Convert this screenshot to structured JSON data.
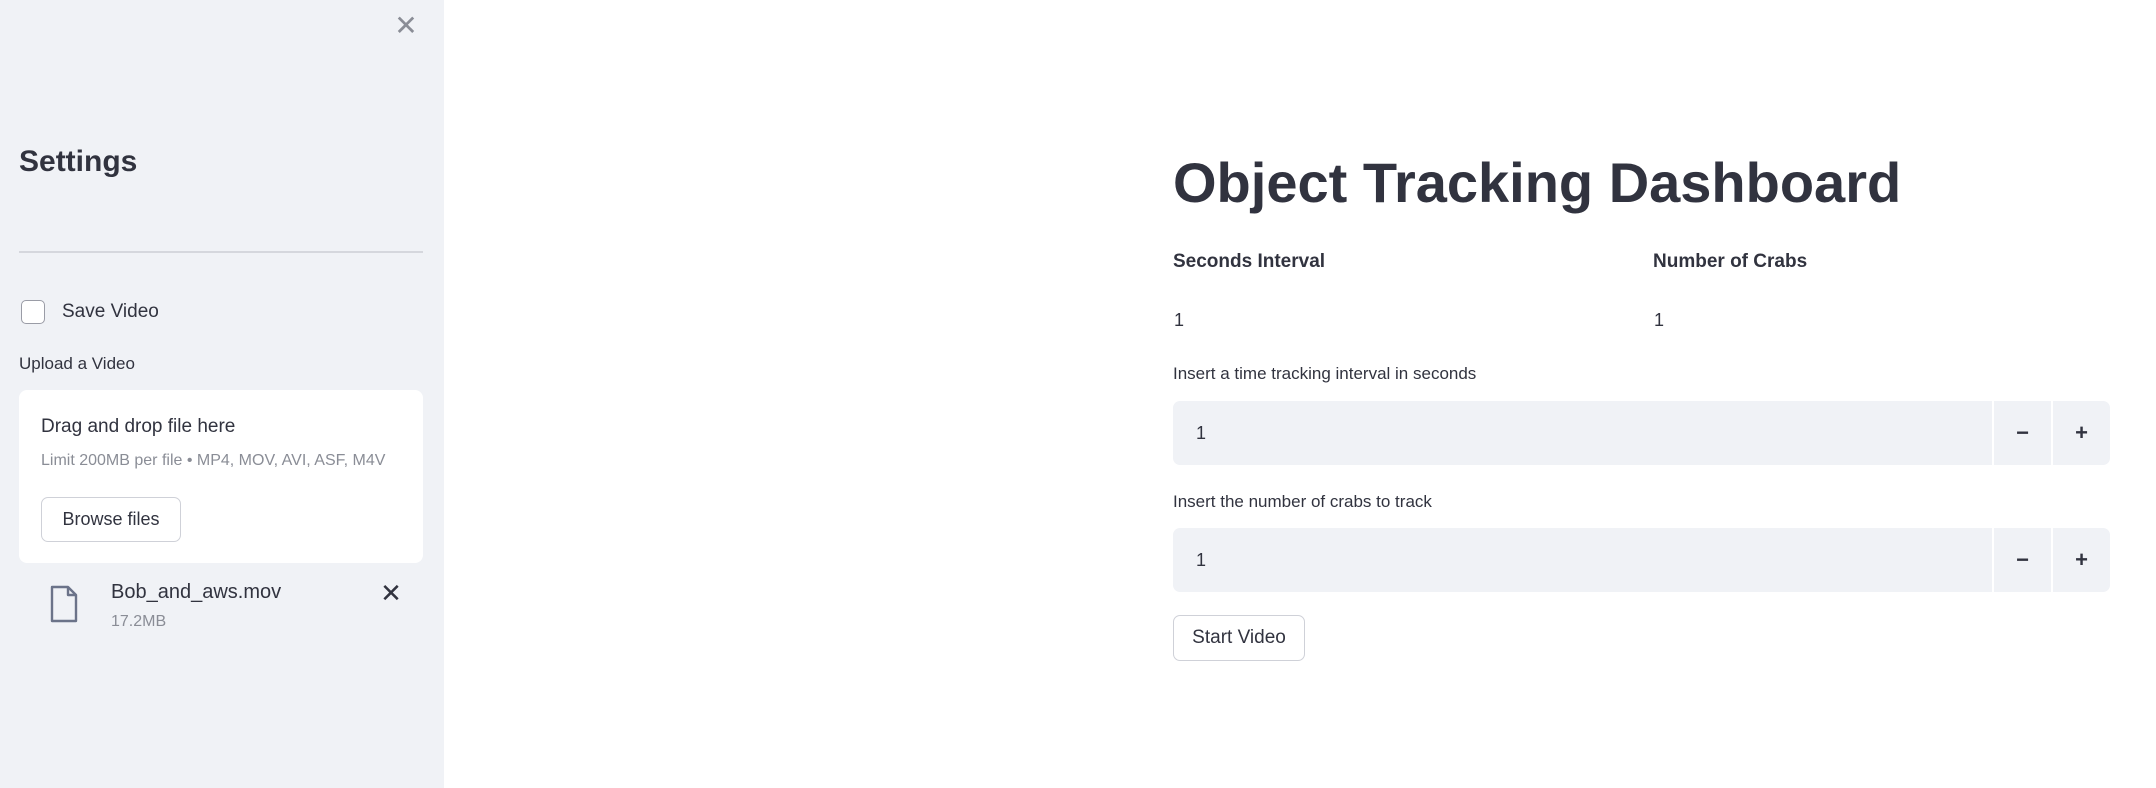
{
  "sidebar": {
    "close_icon": "close-icon",
    "title": "Settings",
    "save_video": {
      "label": "Save Video",
      "checked": false
    },
    "upload": {
      "label": "Upload a Video",
      "dropzone_title": "Drag and drop file here",
      "dropzone_hint": "Limit 200MB per file • MP4, MOV, AVI, ASF, M4V",
      "browse_label": "Browse files"
    },
    "uploaded_file": {
      "icon": "file-icon",
      "name": "Bob_and_aws.mov",
      "size": "17.2MB",
      "remove_icon": "close-icon"
    }
  },
  "main": {
    "title": "Object Tracking Dashboard",
    "metrics": [
      {
        "label": "Seconds Interval",
        "value": "1"
      },
      {
        "label": "Number of Crabs",
        "value": "1"
      }
    ],
    "interval_input": {
      "label": "Insert a time tracking interval in seconds",
      "value": "1",
      "minus": "−",
      "plus": "+"
    },
    "crabs_input": {
      "label": "Insert the number of crabs to track",
      "value": "1",
      "minus": "−",
      "plus": "+"
    },
    "start_button": "Start Video"
  }
}
